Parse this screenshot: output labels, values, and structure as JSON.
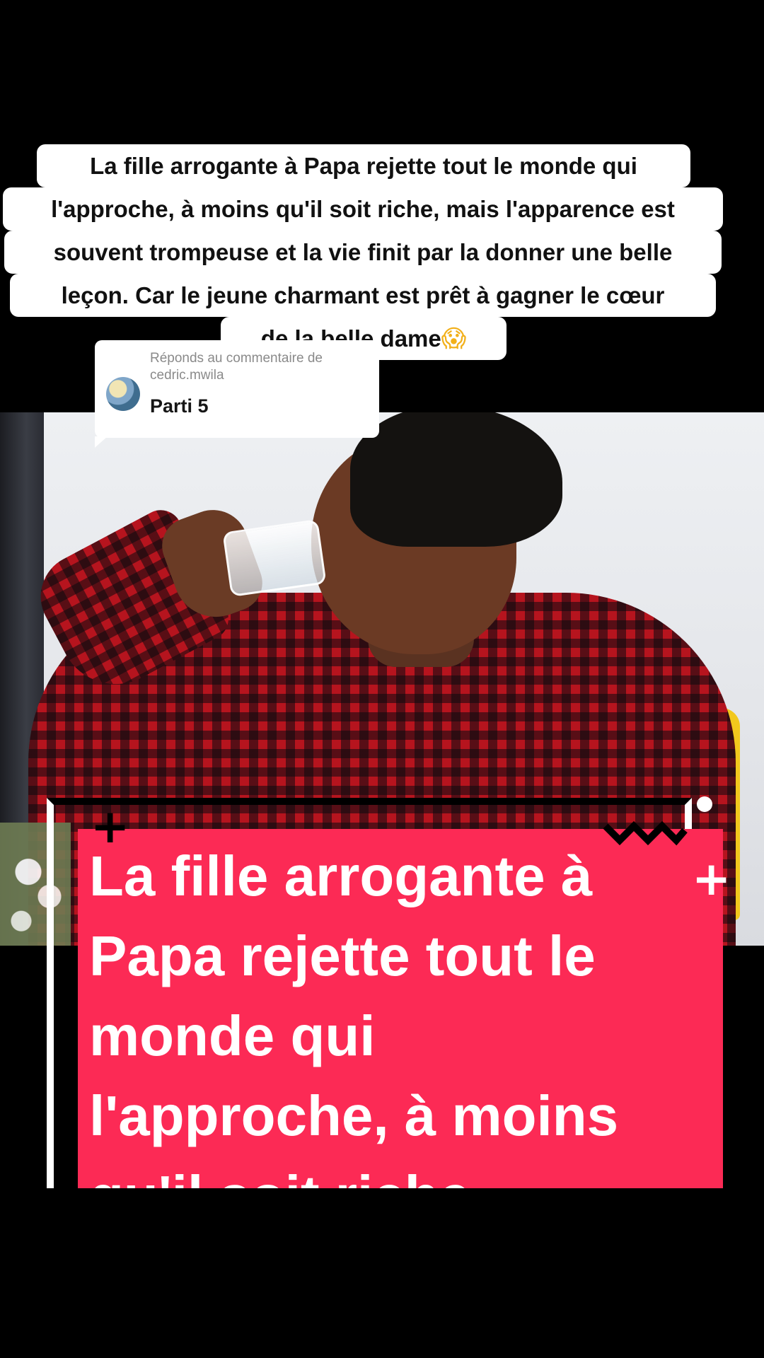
{
  "caption": {
    "lines": [
      "La fille arrogante à Papa rejette tout le monde  qui",
      "l'approche, à moins qu'il soit riche, mais l'apparence est",
      "souvent trompeuse et la vie finit par la donner une belle",
      "leçon. Car le jeune charmant est prêt à gagner le cœur",
      "de la belle dame"
    ],
    "emoji": "😱"
  },
  "reply": {
    "label": "Réponds au commentaire de cedric.mwila",
    "text": "Parti 5"
  },
  "promo": {
    "text": "La fille arrogante à\nPapa rejette tout le\nmonde  qui\nl'approche, à moins\nqu'il soit riche"
  },
  "colors": {
    "promo_background": "#fc2a55",
    "caption_background": "#ffffff",
    "page_background": "#000000"
  }
}
